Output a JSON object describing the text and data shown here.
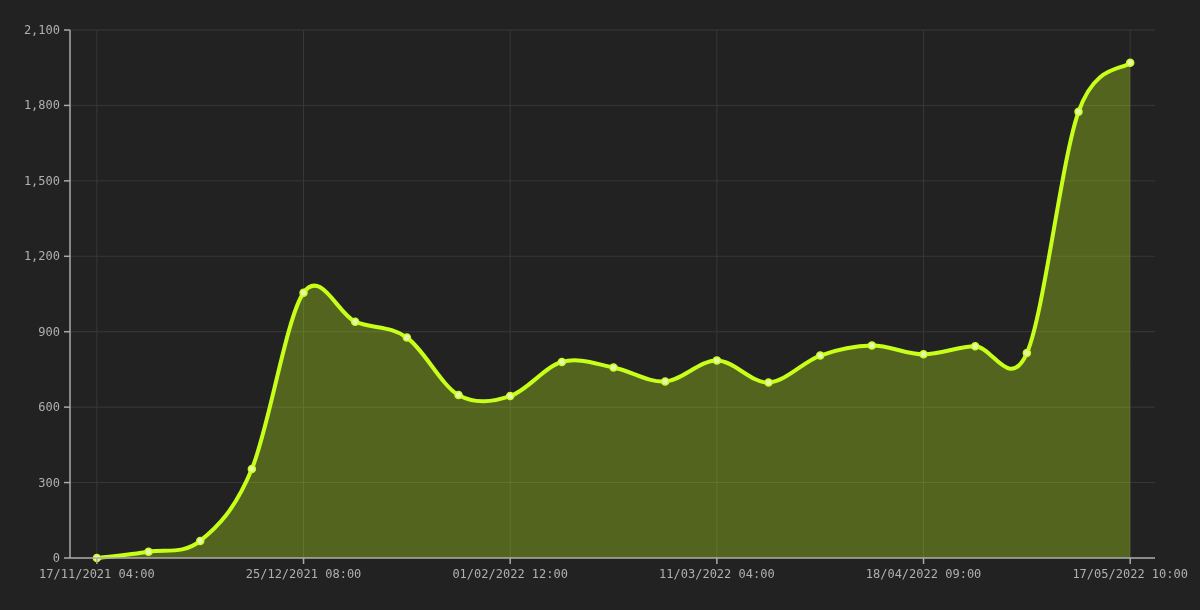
{
  "chart_data": {
    "type": "area",
    "categories": [
      "17/11/2021 04:00",
      null,
      null,
      null,
      "25/12/2021 08:00",
      null,
      null,
      null,
      "01/02/2022 12:00",
      null,
      null,
      null,
      "11/03/2022 04:00",
      null,
      null,
      null,
      "18/04/2022 09:00",
      null,
      null,
      null,
      "17/05/2022 10:00"
    ],
    "series": [
      {
        "color": "#c8ff1a",
        "values": [
          0,
          25,
          68,
          354,
          1055,
          940,
          877,
          648,
          644,
          780,
          758,
          702,
          786,
          698,
          805,
          845,
          810,
          842,
          815,
          1775,
          1970
        ]
      }
    ],
    "grid": true,
    "ylim": [
      0,
      2100
    ],
    "yticks": [
      {
        "value": 0,
        "label": "0"
      },
      {
        "value": 300,
        "label": "300"
      },
      {
        "value": 600,
        "label": "600"
      },
      {
        "value": 900,
        "label": "900"
      },
      {
        "value": 1200,
        "label": "1,200"
      },
      {
        "value": 1500,
        "label": "1,500"
      },
      {
        "value": 1800,
        "label": "1,800"
      },
      {
        "value": 2100,
        "label": "2,100"
      }
    ]
  }
}
